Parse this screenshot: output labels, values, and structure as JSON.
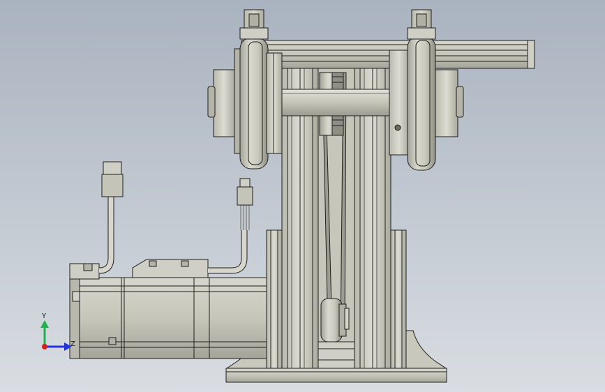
{
  "view": {
    "background_top": "#a9b3bf",
    "background_bottom": "#d9dde2",
    "part_fill": "#c4c4b8",
    "part_light": "#d8d8ce",
    "part_dark": "#8e8e84",
    "edge_color": "#1e1e1e"
  },
  "triad": {
    "y_label": "Y",
    "z_label": "Z",
    "y_color": "#22b14c",
    "x_color": "#2233dd",
    "origin_color": "#d42020"
  }
}
